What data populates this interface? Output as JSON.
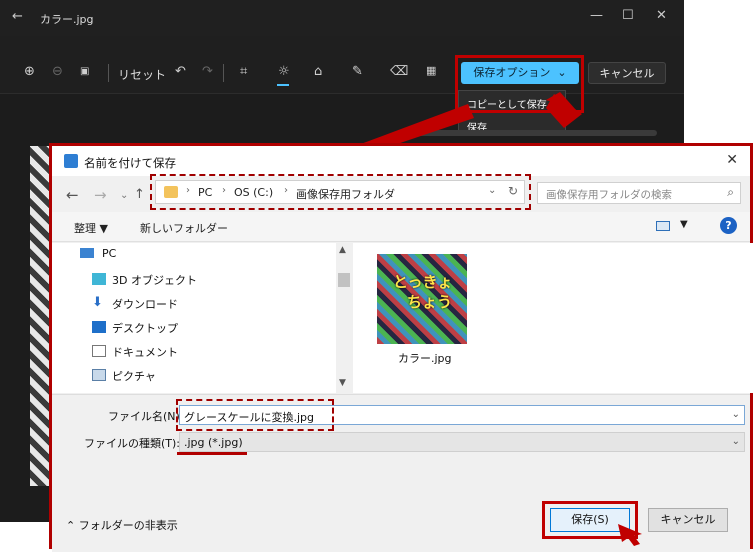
{
  "editor": {
    "file_title": "カラー.jpg",
    "back_glyph": "←",
    "win_min": "—",
    "win_max": "☐",
    "win_close": "✕",
    "toolbar": {
      "reset_label": "リセット",
      "icons": [
        "zoom-in-icon",
        "zoom-out-icon",
        "fit-icon",
        "undo-icon",
        "redo-icon",
        "crop-icon",
        "adjust-icon",
        "markup-icon",
        "draw-icon",
        "erase-icon",
        "filter-icon"
      ]
    },
    "save_options_label": "保存オプション",
    "cancel_label": "キャンセル",
    "save_menu": {
      "copy_save": "コピーとして保存",
      "save": "保存"
    }
  },
  "dialog": {
    "title": "名前を付けて保存",
    "address": {
      "crumbs": [
        "PC",
        "OS (C:)",
        "画像保存用フォルダ"
      ]
    },
    "search_placeholder": "画像保存用フォルダの検索",
    "organize_label": "整理 ▼",
    "new_folder_label": "新しいフォルダー",
    "help_label": "?",
    "nav_items": [
      "PC",
      "3D オブジェクト",
      "ダウンロード",
      "デスクトップ",
      "ドキュメント",
      "ピクチャ"
    ],
    "file": {
      "name": "カラー.jpg",
      "thumb_text_1": "とっきょ",
      "thumb_text_2": "ちょう"
    },
    "filename_label": "ファイル名(N):",
    "filename_value": "グレースケールに変換.jpg",
    "filetype_label": "ファイルの種類(T):",
    "filetype_value": ".jpg (*.jpg)",
    "hide_folders_label": "フォルダーの非表示",
    "save_button": "保存(S)",
    "cancel_button": "キャンセル"
  },
  "colors": {
    "accent": "#4cc2ff",
    "highlight_red": "#c00000",
    "dialog_bg": "#f0f0f0",
    "editor_bg": "#1c1c1c"
  }
}
